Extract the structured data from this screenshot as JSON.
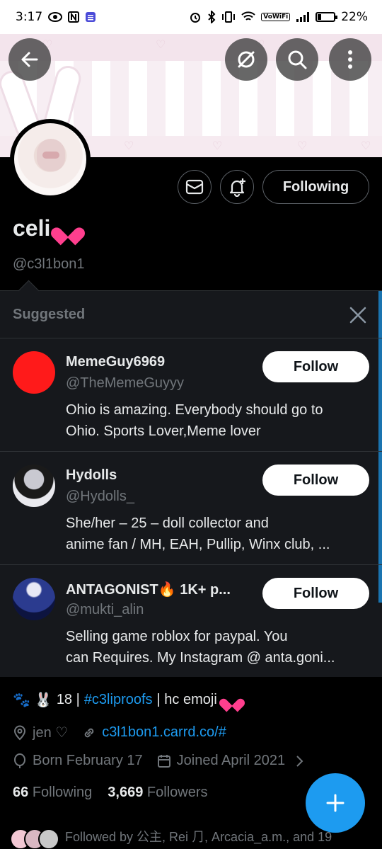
{
  "status_bar": {
    "time": "3:17",
    "battery": "22%",
    "vowifi": "VoWiFi"
  },
  "profile": {
    "name": "celi",
    "handle": "@c3l1bon1",
    "following_button": "Following",
    "bio_number": "18 |",
    "bio_hashtag": "#c3liproofs",
    "bio_rest": "| hc emoji",
    "location": "jen ♡",
    "website": "c3l1bon1.carrd.co/#",
    "born": "Born February 17",
    "joined": "Joined April 2021",
    "following_count": "66",
    "following_label": "Following",
    "followers_count": "3,669",
    "followers_label": "Followers",
    "followed_by": "Followed by 公主, Rei ⺆, Arcacia_a.m., and 19"
  },
  "suggested": {
    "title": "Suggested",
    "items": [
      {
        "name": "MemeGuy6969",
        "handle": "@TheMemeGuyyy",
        "bio_line1": "Ohio is amazing. Everybody should go to",
        "bio_line2": "Ohio. Sports Lover,Meme lover",
        "follow_label": "Follow"
      },
      {
        "name": "Hydolls",
        "handle": "@Hydolls_",
        "bio_line1": "She/her – 25 – doll collector and",
        "bio_line2": "anime fan / MH, EAH, Pullip, Winx club, ...",
        "follow_label": "Follow"
      },
      {
        "name": "ANTAGONIST🔥 1K+ p...",
        "handle": "@mukti_alin",
        "bio_line1": "Selling game roblox for paypal.   You",
        "bio_line2": "can Requires. My Instagram @ anta.goni...",
        "follow_label": "Follow"
      }
    ]
  },
  "colors": {
    "accent": "#1d9bf0",
    "background": "#000000",
    "panel": "#16181c",
    "muted": "#71767b"
  }
}
